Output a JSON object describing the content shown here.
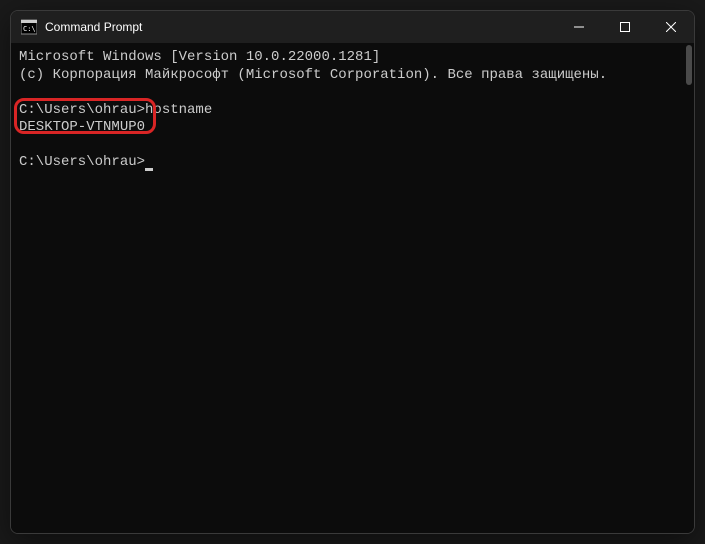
{
  "titlebar": {
    "title": "Command Prompt",
    "icon_name": "cmd-icon"
  },
  "terminal": {
    "line_version": "Microsoft Windows [Version 10.0.22000.1281]",
    "line_copyright": "(c) Корпорация Майкрософт (Microsoft Corporation). Все права защищены.",
    "line_cmd1": "C:\\Users\\ohrau>hostname",
    "line_output1": "DESKTOP-VTNMUP0",
    "line_prompt": "C:\\Users\\ohrau>"
  },
  "highlight": {
    "target": "hostname-output"
  }
}
